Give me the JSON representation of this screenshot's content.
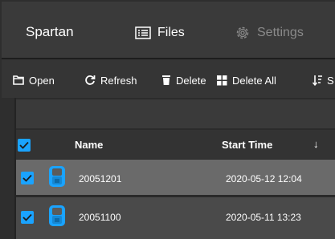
{
  "app": {
    "title": "Spartan"
  },
  "nav": {
    "files_label": "Files",
    "settings_label": "Settings"
  },
  "toolbar": {
    "open_label": "Open",
    "refresh_label": "Refresh",
    "delete_label": "Delete",
    "delete_all_label": "Delete All",
    "sort_label": "S"
  },
  "table": {
    "columns": {
      "name": "Name",
      "start_time": "Start Time",
      "sort_indicator": "↓"
    },
    "rows": [
      {
        "name": "20051201",
        "start_time": "2020-05-12 12:04",
        "checked": true
      },
      {
        "name": "20051100",
        "start_time": "2020-05-11 13:23",
        "checked": true
      }
    ]
  },
  "colors": {
    "accent": "#1aa3ff",
    "selected_row": "#6a6a6a",
    "row": "#4a4a4a",
    "inactive_nav": "#8a8a8a"
  }
}
